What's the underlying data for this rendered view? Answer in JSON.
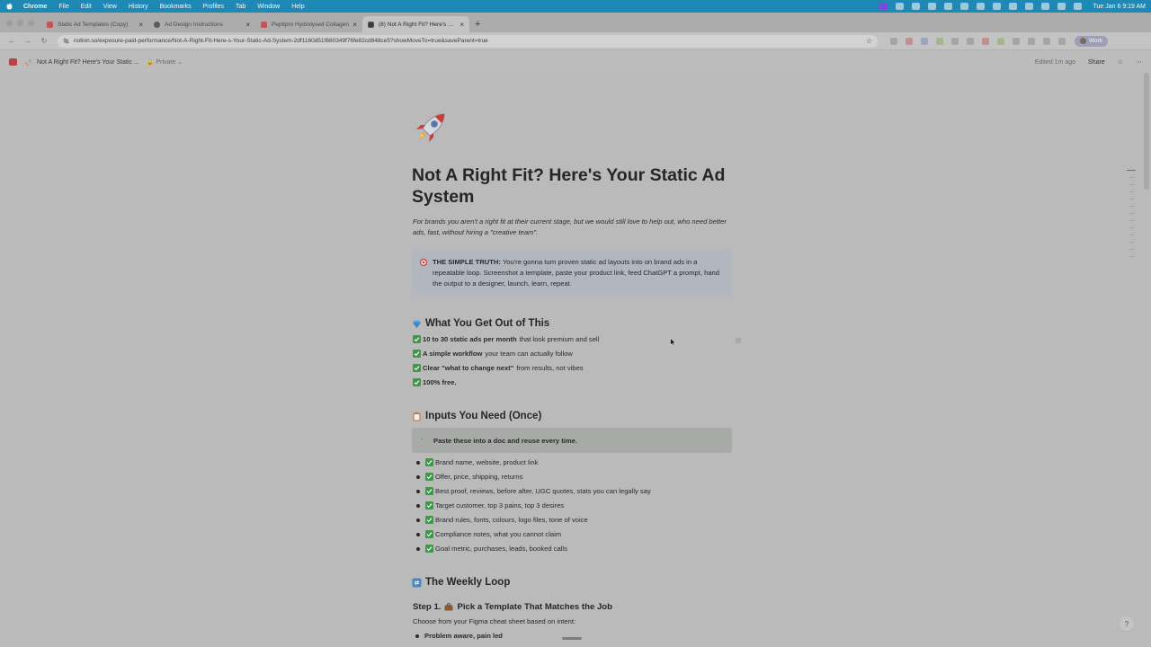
{
  "menubar": {
    "app": "Chrome",
    "items": [
      "File",
      "Edit",
      "View",
      "History",
      "Bookmarks",
      "Profiles",
      "Tab",
      "Window",
      "Help"
    ],
    "clock": "Tue Jan 6  9:19 AM"
  },
  "tabs": [
    {
      "title": "Static Ad Templates (Copy)",
      "active": false
    },
    {
      "title": "Ad Design Instructions",
      "active": false
    },
    {
      "title": "Peptipro Hydrolysed Collagen",
      "active": false
    },
    {
      "title": "(8) Not A Right Fit? Here's Your",
      "active": true
    }
  ],
  "toolbar": {
    "url": "notion.so/exposure-paid-performance/Not-A-Right-Fit-Here-s-Your-Static-Ad-System-2df1160d51f680349f76fe82cd848ce5?showMoveTo=true&saveParent=true",
    "profile": "Work"
  },
  "notion_top": {
    "page_title": "Not A Right Fit? Here's Your Static ...",
    "visibility": "Private",
    "edited": "Edited 1m ago",
    "share": "Share"
  },
  "page": {
    "title": "Not A Right Fit? Here's Your Static Ad System",
    "subtitle": "For brands you aren't a right fit at their current stage, but we would still love to help out, who need better ads, fast, without hiring a \"creative team\".",
    "callout": {
      "bold": "THE SIMPLE TRUTH:",
      "text": "You're gonna turn proven static ad layouts into on brand ads in a repeatable loop. Screenshot a template, paste your product link, feed ChatGPT a prompt, hand the output to a designer, launch, learn, repeat."
    },
    "section1": {
      "heading": "What You Get Out of This",
      "items": [
        {
          "bold": "10 to 30 static ads per month",
          "rest": "that look premium and sell"
        },
        {
          "bold": "A simple workflow",
          "rest": "your team can actually follow"
        },
        {
          "bold": "Clear \"what to change next\"",
          "rest": "from results, not vibes"
        },
        {
          "bold": "100% free.",
          "rest": ""
        }
      ]
    },
    "section2": {
      "heading": "Inputs You Need (Once)",
      "box": "Paste these into a doc and reuse every time.",
      "bullets": [
        "Brand name, website, product link",
        "Offer, price, shipping, returns",
        "Best proof, reviews, before after, UGC quotes, stats you can legally say",
        "Target customer, top 3 pains, top 3 desires",
        "Brand rules, fonts, colours, logo files, tone of voice",
        "Compliance notes, what you cannot claim",
        "Goal metric, purchases, leads, booked calls"
      ]
    },
    "section3": {
      "heading": "The Weekly Loop",
      "step_label": "Step 1.",
      "step_title": "Pick a Template That Matches the Job",
      "step_text": "Choose from your Figma cheat sheet based on intent:",
      "first_bullet": "Problem aware, pain led"
    }
  }
}
